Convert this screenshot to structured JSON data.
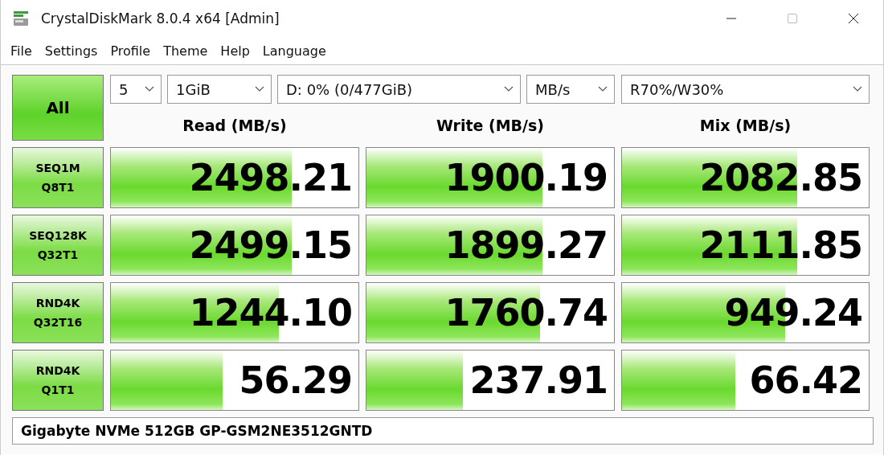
{
  "window": {
    "title": "CrystalDiskMark 8.0.4 x64 [Admin]"
  },
  "menu": [
    "File",
    "Settings",
    "Profile",
    "Theme",
    "Help",
    "Language"
  ],
  "all_button": "All",
  "selectors": {
    "count": "5",
    "size": "1GiB",
    "drive": "D: 0% (0/477GiB)",
    "unit": "MB/s",
    "mix": "R70%/W30%"
  },
  "columns": [
    "Read (MB/s)",
    "Write (MB/s)",
    "Mix (MB/s)"
  ],
  "rows": [
    {
      "test": [
        "SEQ1M",
        "Q8T1"
      ],
      "results": [
        {
          "value": "2498.21",
          "level": 0.73
        },
        {
          "value": "1900.19",
          "level": 0.71
        },
        {
          "value": "2082.85",
          "level": 0.71
        }
      ]
    },
    {
      "test": [
        "SEQ128K",
        "Q32T1"
      ],
      "results": [
        {
          "value": "2499.15",
          "level": 0.73
        },
        {
          "value": "1899.27",
          "level": 0.71
        },
        {
          "value": "2111.85",
          "level": 0.71
        }
      ]
    },
    {
      "test": [
        "RND4K",
        "Q32T16"
      ],
      "results": [
        {
          "value": "1244.10",
          "level": 0.68
        },
        {
          "value": "1760.74",
          "level": 0.7
        },
        {
          "value": "949.24",
          "level": 0.66
        }
      ]
    },
    {
      "test": [
        "RND4K",
        "Q1T1"
      ],
      "results": [
        {
          "value": "56.29",
          "level": 0.45
        },
        {
          "value": "237.91",
          "level": 0.39
        },
        {
          "value": "66.42",
          "level": 0.46
        }
      ]
    }
  ],
  "comment": "Gigabyte NVMe 512GB GP-GSM2NE3512GNTD"
}
